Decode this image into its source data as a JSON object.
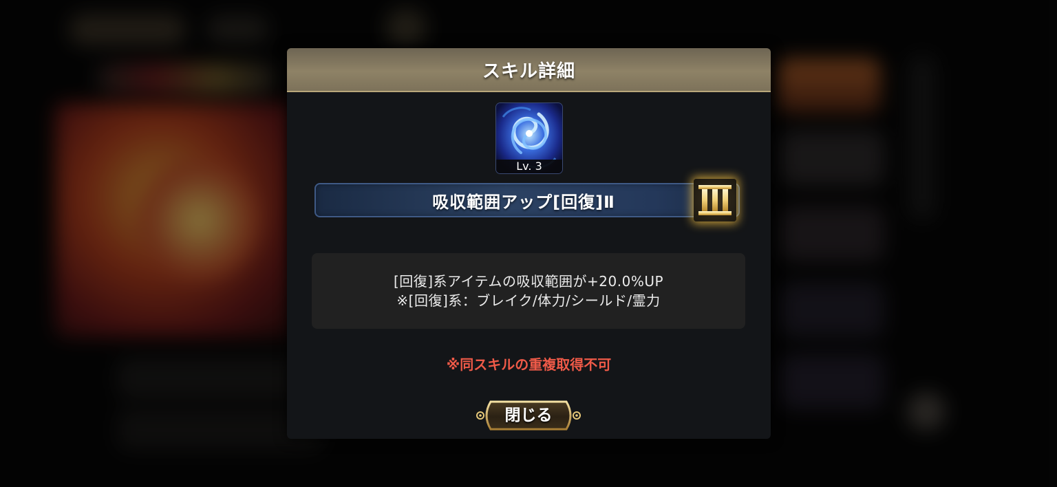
{
  "dialog": {
    "title": "スキル詳細",
    "skill": {
      "icon": "blue-vortex-icon",
      "level_label": "Lv. 3",
      "name": "吸収範囲アップ[回復]Ⅱ",
      "rank_icon": "roman-numeral-three-icon"
    },
    "description": [
      "[回復]系アイテムの吸収範囲が+20.0%UP",
      "※[回復]系：ブレイク/体力/シールド/霊力"
    ],
    "warning": "※同スキルの重複取得不可",
    "close_label": "閉じる"
  },
  "colors": {
    "header_gold": "#8e8266",
    "panel_bg": "#131518",
    "warning_red": "#ef5a48",
    "name_bar_blue": "#2c4263",
    "button_gold": "#c9a55a"
  }
}
